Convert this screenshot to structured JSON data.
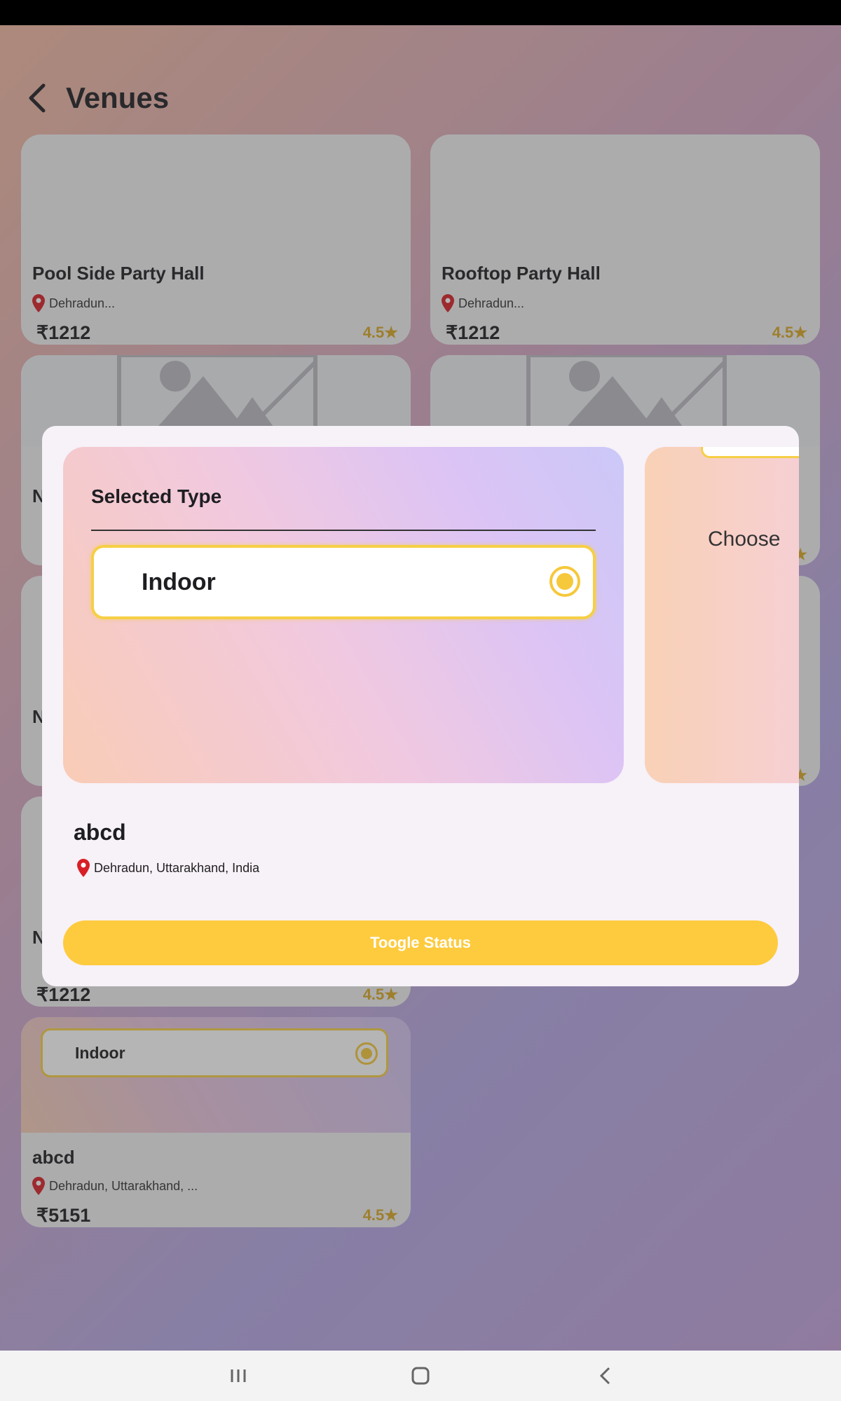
{
  "header": {
    "title": "Venues"
  },
  "cards": [
    {
      "name": "Pool Side Party Hall",
      "location": "Dehradun...",
      "price": "₹1212",
      "rating": "4.5★"
    },
    {
      "name": "Rooftop Party Hall",
      "location": "Dehradun...",
      "price": "₹1212",
      "rating": "4.5★"
    },
    {
      "partial_name": "N"
    },
    {
      "partial_rating": "★"
    },
    {
      "partial_name": "N"
    },
    {
      "partial_rating": "★"
    },
    {
      "partial_name": "N",
      "price": "₹1212",
      "rating": "4.5★"
    },
    {
      "option_label": "Indoor",
      "name": "abcd",
      "location": "Dehradun, Uttarakhand, ...",
      "price": "₹5151",
      "rating": "4.5★"
    }
  ],
  "modal": {
    "selected_type_title": "Selected Type",
    "option_label": "Indoor",
    "second_panel_text": "Choose",
    "venue_name": "abcd",
    "venue_location": "Dehradun, Uttarakhand, India",
    "action_label": "Toogle Status"
  },
  "colors": {
    "accent": "#fecb3e",
    "pin": "#d81f26",
    "rating": "#d9a824"
  },
  "icons": {
    "back": "chevron-left-icon",
    "location": "location-pin-icon",
    "radio": "radio-selected-icon"
  }
}
